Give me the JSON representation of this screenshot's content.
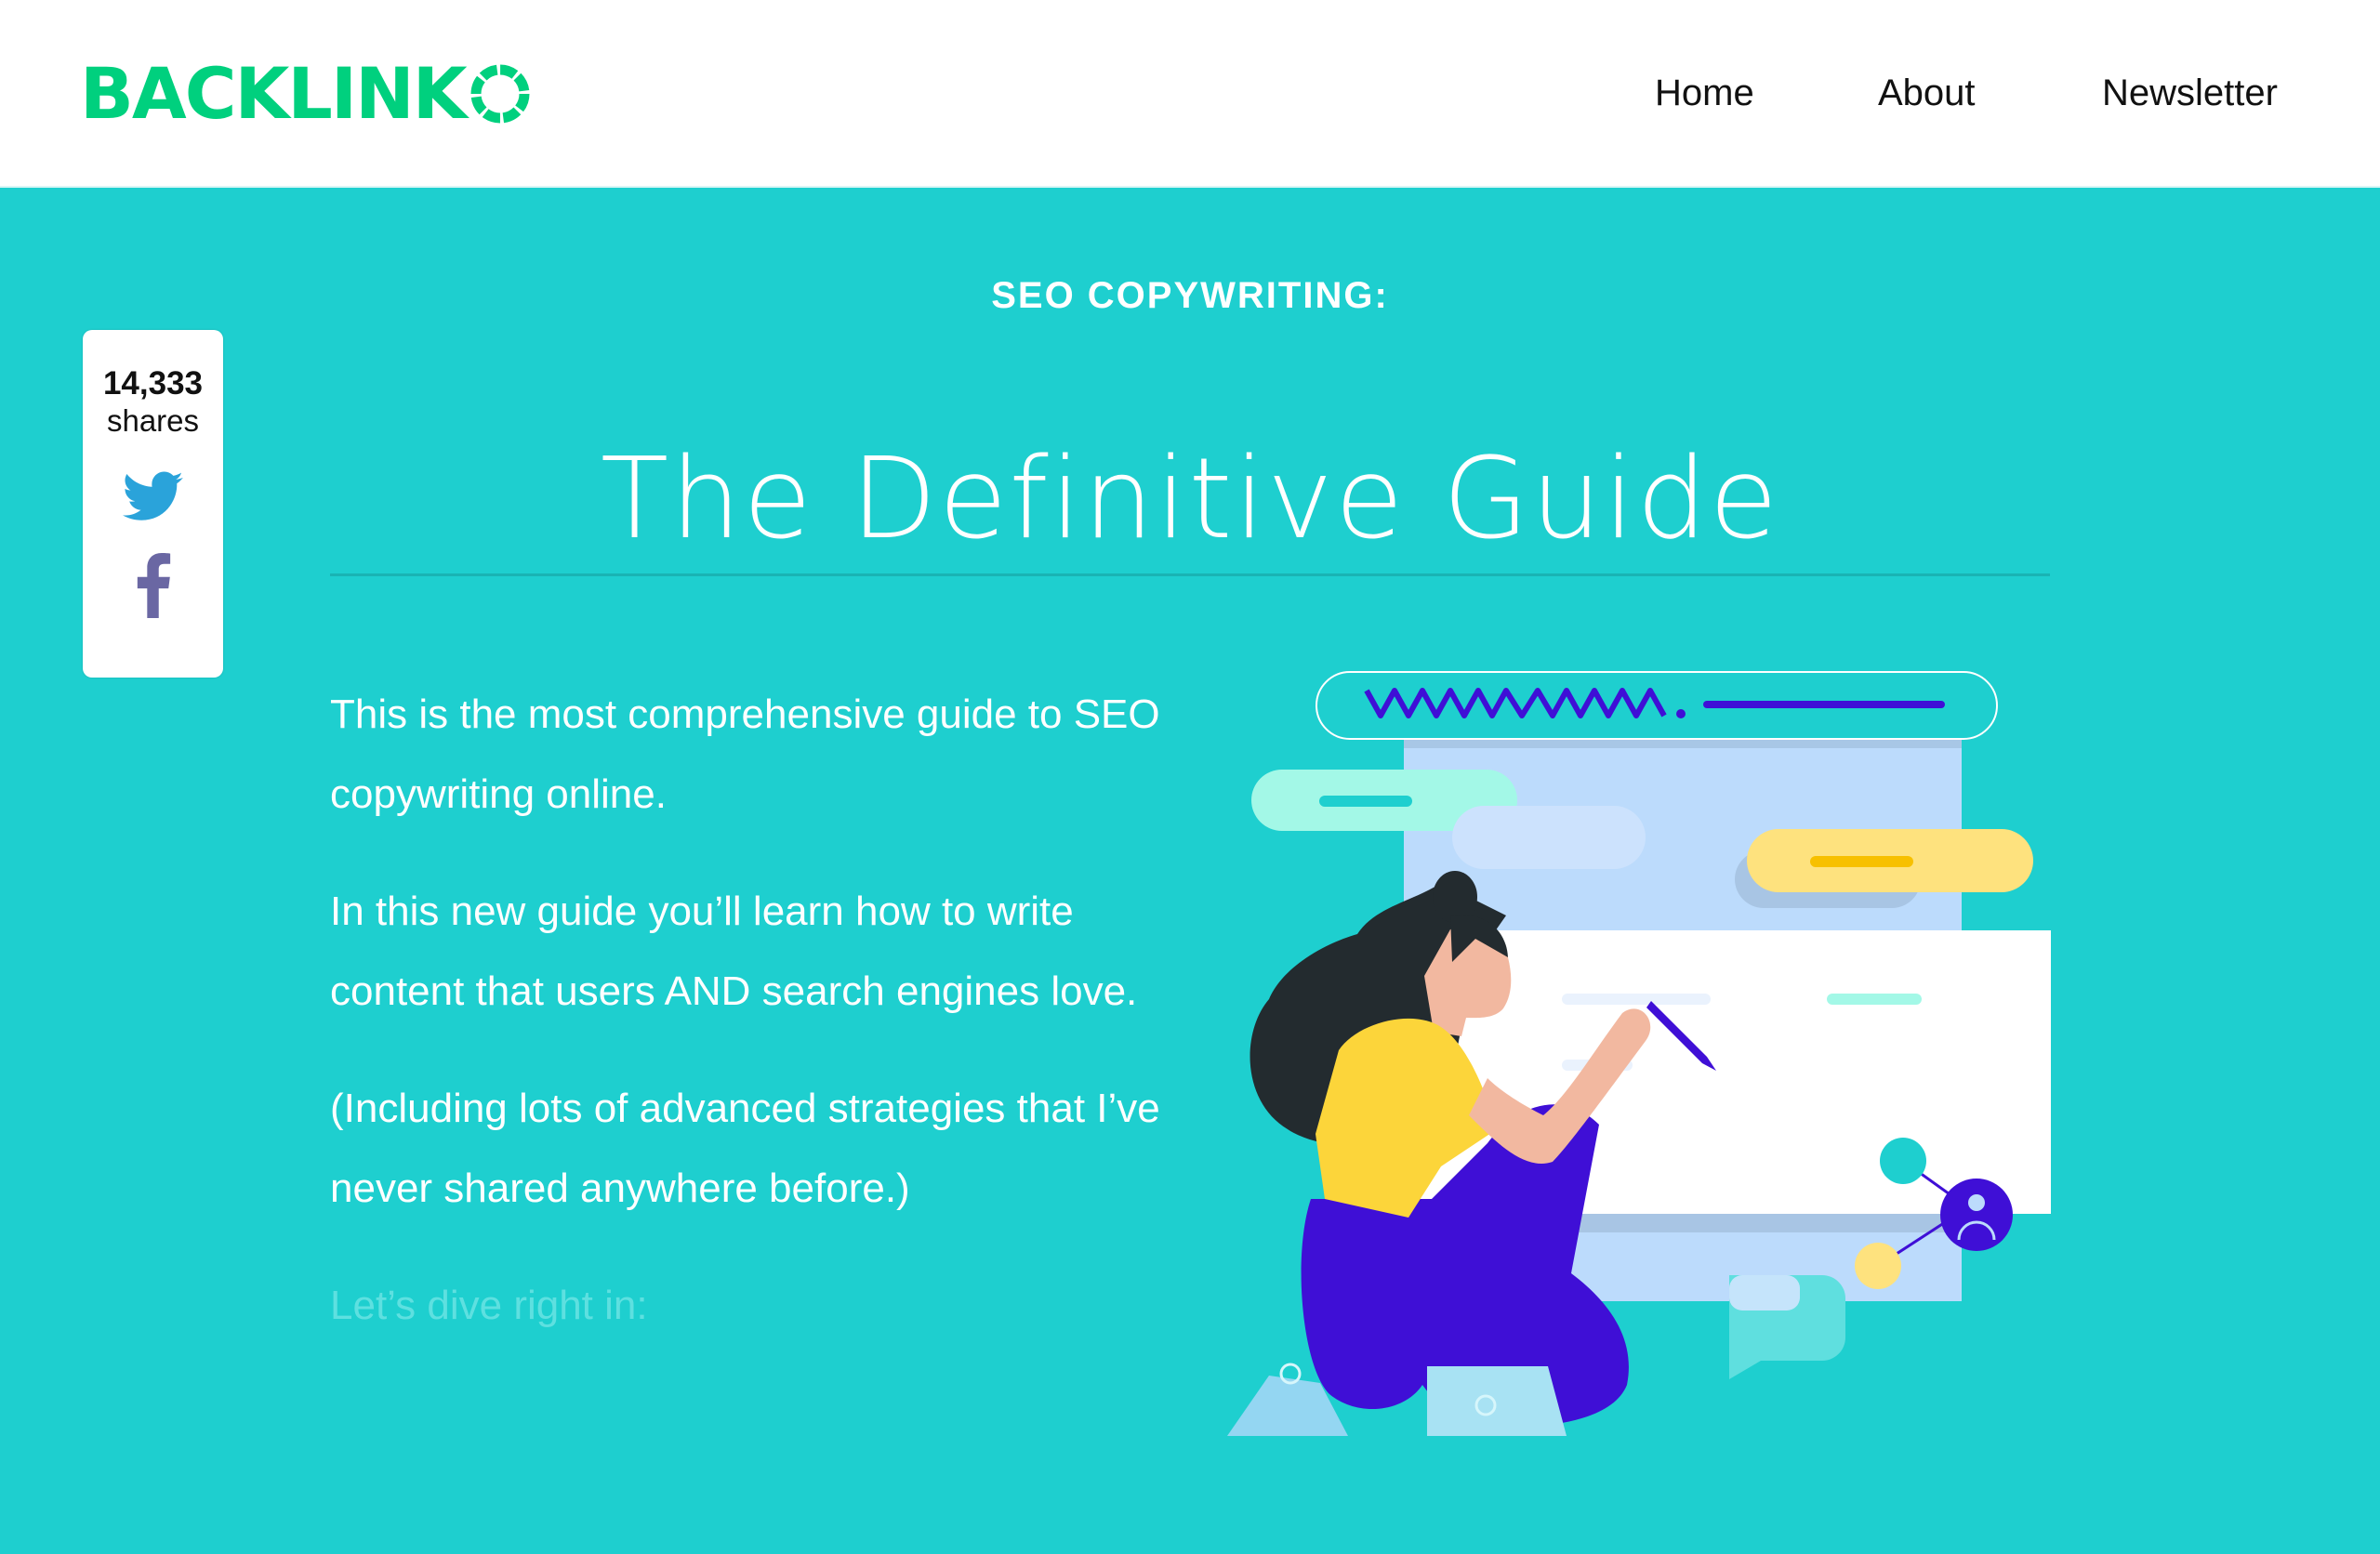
{
  "header": {
    "logo_text": "BACKLINK",
    "logo_ring_label": "O",
    "brand_color": "#00d07e",
    "nav": [
      {
        "label": "Home"
      },
      {
        "label": "About"
      },
      {
        "label": "Newsletter"
      }
    ]
  },
  "share": {
    "count": "14,333",
    "label": "shares",
    "twitter_icon": "twitter-bird-icon",
    "facebook_icon": "facebook-f-icon",
    "twitter_color": "#2aa3da",
    "facebook_color": "#6a67a3"
  },
  "hero": {
    "kicker": "SEO COPYWRITING:",
    "title": "The Definitive Guide",
    "background_color": "#1ecfcf",
    "paragraphs": [
      "This is the most comprehensive guide to SEO copywriting online.",
      "In this new guide you’ll learn how to write content that users AND search engines love.",
      "(Including lots of advanced strategies that I’ve never shared anywhere before.)"
    ],
    "cta_faded": "Let’s dive right in:"
  },
  "illustration": {
    "description": "woman writing on a web page with url bar",
    "url_bar_text": "www."
  }
}
